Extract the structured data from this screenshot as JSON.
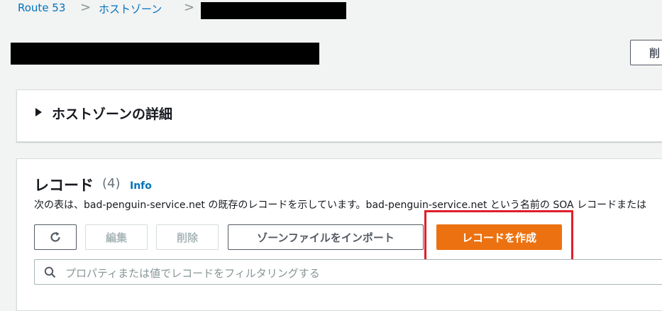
{
  "breadcrumb": {
    "items": [
      "Route 53",
      "ホストゾーン"
    ],
    "separator": ">"
  },
  "header": {
    "delete_button_label": "削"
  },
  "details": {
    "title": "ホストゾーンの詳細",
    "expanded": false
  },
  "records": {
    "title": "レコード",
    "count": "(4)",
    "info_link": "Info",
    "description": "次の表は、bad-penguin-service.net の既存のレコードを示しています。bad-penguin-service.net という名前の SOA レコードまたは"
  },
  "toolbar": {
    "refresh_icon": "refresh-icon",
    "edit_label": "編集",
    "delete_label": "削除",
    "import_label": "ゾーンファイルをインポート",
    "create_label": "レコードを作成"
  },
  "search": {
    "placeholder": "プロパティまたは値でレコードをフィルタリングする",
    "icon": "search-icon"
  },
  "colors": {
    "primary": "#ec7211",
    "link": "#0073bb",
    "highlight": "#df1f2b",
    "background": "#f2f3f3"
  }
}
